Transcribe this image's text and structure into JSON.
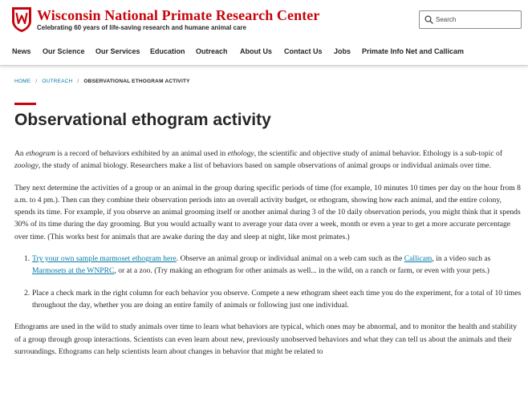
{
  "header": {
    "site_title": "Wisconsin National Primate Research Center",
    "tagline": "Celebrating 60 years of life-saving research and humane animal care",
    "search_placeholder": "Search"
  },
  "nav": {
    "items": [
      "News",
      "Our Science",
      "Our Services",
      "Education",
      "Outreach",
      "About Us",
      "Contact Us",
      "Jobs",
      "Primate Info Net and Callicam"
    ]
  },
  "breadcrumb": {
    "home": "HOME",
    "sep": "/",
    "outreach": "OUTREACH",
    "current": "OBSERVATIONAL ETHOGRAM ACTIVITY"
  },
  "page_title": "Observational ethogram activity",
  "content": {
    "p1": {
      "a": "An ",
      "b": "ethogram",
      "c": " is a record of behaviors exhibited by an animal used in ",
      "d": "ethology",
      "e": ", the scientific and objective study of animal behavior. Ethology is a sub-topic of ",
      "f": "zoology",
      "g": ", the study of animal biology. Researchers make a list of behaviors based on sample observations of animal groups or individual animals over time."
    },
    "p2": "They next determine the activities of a group or an animal in the group during specific periods of time (for example, 10 minutes 10 times per day on the hour from 8 a.m. to 4 pm.). Then can they combine their observation periods into an overall activity budget, or ethogram, showing how each animal, and the entire colony, spends its time. For example, if you observe an animal grooming itself or another animal during 3 of the 10 daily observation periods, you might think that it spends 30% of its time during the day grooming. But you would actually want to average your data over a week, month or even a year to get a more accurate percentage over time. (This works best for animals that are awake during the day and sleep at night, like most primates.)",
    "list": {
      "item1": {
        "num": "1.",
        "link1": "Try your own sample marmoset ethogram here",
        "text1": ". Observe an animal group or individual animal on a web cam such as the ",
        "link2": "Callicam",
        "text2": ", in a video such as ",
        "link3": "Marmosets at the WNPRC",
        "text3": ", or at a zoo. (Try making an ethogram for other animals as well... in the wild, on a ranch or farm, or even with your pets.)"
      },
      "item2": {
        "num": "2.",
        "text": "Place a check mark in the right column for each behavior you observe. Compete a new ethogram sheet each time you do the experiment, for a total of 10 times throughout the day, whether you are doing an entire family of animals or following just one individual."
      }
    },
    "p3": "Ethograms are used in the wild to study animals over time to learn what behaviors are typical, which ones may be abnormal, and to monitor the health and stability of a group through group interactions. Scientists can even learn about new, previously unobserved behaviors and what they can tell us about the animals and their surroundings. Ethograms can help scientists learn about changes in behavior that might be related to"
  },
  "colors": {
    "brand_red": "#c5050c",
    "link_blue": "#0479a8",
    "text": "#282728"
  },
  "icons": {
    "crest": "uw-crest-icon",
    "search": "search-icon"
  }
}
